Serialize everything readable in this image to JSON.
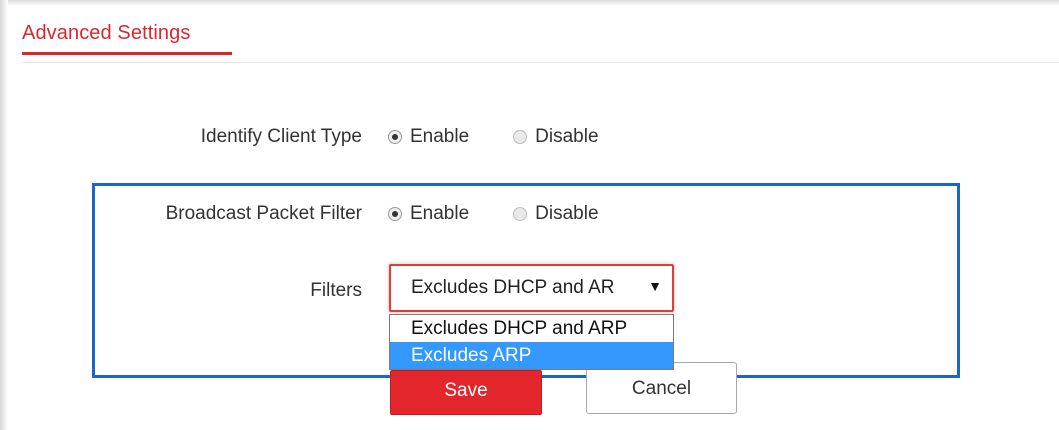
{
  "header": {
    "title": "Advanced Settings"
  },
  "identify_client_type": {
    "label": "Identify Client Type",
    "options": [
      {
        "label": "Enable",
        "checked": true
      },
      {
        "label": "Disable",
        "checked": false
      }
    ]
  },
  "broadcast_packet_filter": {
    "label": "Broadcast Packet Filter",
    "options": [
      {
        "label": "Enable",
        "checked": true
      },
      {
        "label": "Disable",
        "checked": false
      }
    ]
  },
  "filters": {
    "label": "Filters",
    "selected_display": "Excludes DHCP and AR",
    "arrow": "▼",
    "options": [
      "Excludes DHCP and ARP",
      "Excludes ARP"
    ],
    "highlighted_option": "Excludes ARP"
  },
  "actions": {
    "save_label": "Save",
    "cancel_label": "Cancel"
  },
  "colors": {
    "accent": "#d8282f",
    "highlight_box": "#1a66c9",
    "dropdown_highlight": "#3399ff"
  }
}
